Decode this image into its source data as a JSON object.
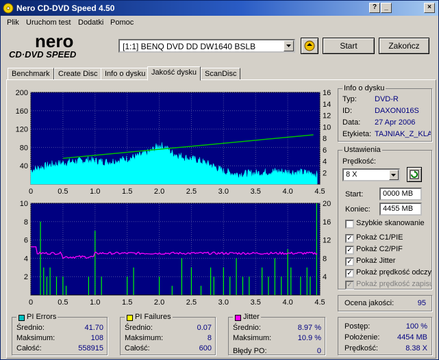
{
  "window": {
    "title": "Nero CD-DVD Speed 4.50",
    "controls": [
      "help",
      "minimize",
      "close"
    ]
  },
  "menu": [
    "Plik",
    "Uruchom test",
    "Dodatki",
    "Pomoc"
  ],
  "logo": {
    "brand": "nero",
    "product": "CD·DVD SPEED"
  },
  "drive": {
    "selected": "[1:1]  BENQ DVD DD DW1640 BSLB"
  },
  "buttons": {
    "start": "Start",
    "stop": "Zakończ"
  },
  "tabs": [
    {
      "label": "Benchmark",
      "active": false
    },
    {
      "label": "Create Disc",
      "active": false
    },
    {
      "label": "Info o dysku",
      "active": false
    },
    {
      "label": "Jakość dysku",
      "active": true
    },
    {
      "label": "ScanDisc",
      "active": false
    }
  ],
  "disc_info": {
    "title": "Info o dysku",
    "labels": {
      "type": "Typ:",
      "id": "ID:",
      "date": "Data:",
      "label": "Etykieta:"
    },
    "values": {
      "type": "DVD-R",
      "id": "DAXON016S",
      "date": "27 Apr 2006",
      "label": "TAJNIAK_Z_KLA"
    }
  },
  "settings": {
    "title": "Ustawienia",
    "speed_label": "Prędkość:",
    "speed_value": "8 X",
    "start_label": "Start:",
    "start_value": "0000 MB",
    "end_label": "Koniec:",
    "end_value": "4455 MB",
    "checkboxes": [
      {
        "label": "Szybkie skanowanie",
        "checked": false,
        "disabled": false
      },
      {
        "label": "Pokaż C1/PIE",
        "checked": true,
        "disabled": false
      },
      {
        "label": "Pokaż C2/PIF",
        "checked": true,
        "disabled": false
      },
      {
        "label": "Pokaż Jitter",
        "checked": true,
        "disabled": false
      },
      {
        "label": "Pokaż prędkość odczy",
        "checked": true,
        "disabled": false
      },
      {
        "label": "Pokaż prędkość zapisu",
        "checked": true,
        "disabled": true
      }
    ]
  },
  "quality": {
    "label": "Ocena jakości:",
    "value": "95"
  },
  "stats": {
    "pi_errors": {
      "title": "PI Errors",
      "color": "#00c0c0",
      "avg_label": "Średnio:",
      "avg": "41.70",
      "max_label": "Maksimum:",
      "max": "108",
      "total_label": "Całość:",
      "total": "558915"
    },
    "pi_failures": {
      "title": "PI Failures",
      "color": "#ffff00",
      "avg_label": "Średnio:",
      "avg": "0.07",
      "max_label": "Maksimum:",
      "max": "8",
      "total_label": "Całość:",
      "total": "600"
    },
    "jitter": {
      "title": "Jitter",
      "color": "#ff00ff",
      "avg_label": "Średnio:",
      "avg": "8.97 %",
      "max_label": "Maksimum:",
      "max": "10.9 %",
      "po_label": "Błędy PO:",
      "po": "0"
    },
    "progress": {
      "progress_label": "Postęp:",
      "progress": "100 %",
      "position_label": "Położenie:",
      "position": "4454 MB",
      "speed_label": "Prędkość:",
      "speed": "8.38 X"
    }
  },
  "chart_data": [
    {
      "type": "area",
      "series": [
        {
          "name": "PI Errors",
          "color": "#00ffff"
        },
        {
          "name": "Read speed",
          "color": "#00c000",
          "x": [
            0.5,
            4.4
          ],
          "y": [
            4.5,
            8.6
          ]
        }
      ],
      "x_ticks": [
        "0",
        "0.5",
        "1.0",
        "1.5",
        "2.0",
        "2.5",
        "3.0",
        "3.5",
        "4.0",
        "4.5"
      ],
      "y_left_ticks": [
        "200",
        "160",
        "120",
        "80",
        "40"
      ],
      "y_right_ticks": [
        "16",
        "14",
        "12",
        "10",
        "8",
        "6",
        "4",
        "2"
      ],
      "xlim": [
        0,
        4.5
      ],
      "ylim_left": [
        0,
        200
      ],
      "ylim_right": [
        0,
        16
      ]
    },
    {
      "type": "bar",
      "series": [
        {
          "name": "PI Failures",
          "color": "#00ff00"
        },
        {
          "name": "Jitter",
          "color": "#ff00ff"
        }
      ],
      "x_ticks": [
        "0",
        "0.5",
        "1.0",
        "1.5",
        "2.0",
        "2.5",
        "3.0",
        "3.5",
        "4.0",
        "4.5"
      ],
      "y_left_ticks": [
        "10",
        "8",
        "6",
        "4",
        "2"
      ],
      "y_right_ticks": [
        "20",
        "16",
        "12",
        "8",
        "4"
      ],
      "xlim": [
        0,
        4.5
      ],
      "ylim_left": [
        0,
        10
      ],
      "ylim_right": [
        0,
        20
      ]
    }
  ]
}
